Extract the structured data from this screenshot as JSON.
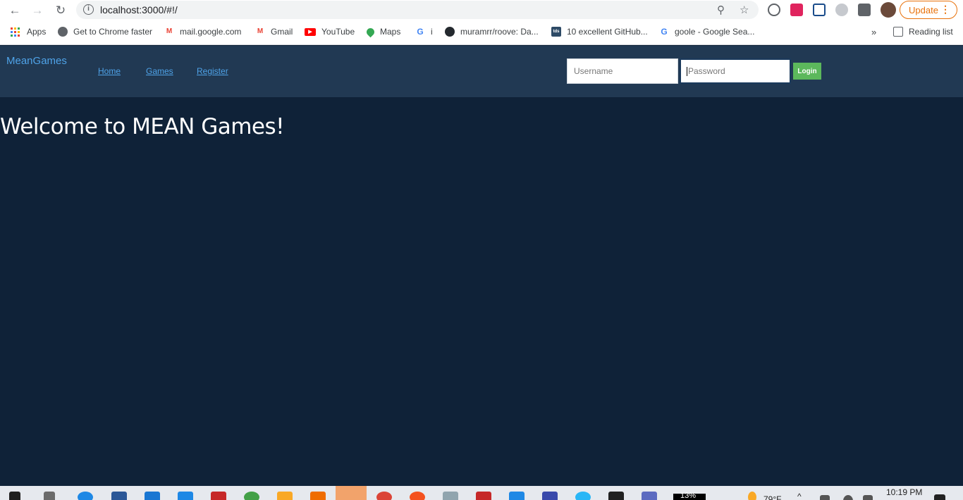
{
  "browser": {
    "url": "localhost:3000/#!/",
    "update_label": "Update",
    "reading_list_label": "Reading list",
    "more_bookmarks": "»"
  },
  "bookmarks": [
    {
      "label": "Apps",
      "icon": "apps-grid-icon"
    },
    {
      "label": "Get to Chrome faster",
      "icon": "chrome-globe-icon"
    },
    {
      "label": "mail.google.com",
      "icon": "gmail-icon"
    },
    {
      "label": "Gmail",
      "icon": "gmail-icon"
    },
    {
      "label": "YouTube",
      "icon": "youtube-icon"
    },
    {
      "label": "Maps",
      "icon": "maps-pin-icon"
    },
    {
      "label": "i",
      "icon": "google-icon"
    },
    {
      "label": "muramrr/roove: Da...",
      "icon": "github-icon"
    },
    {
      "label": "10 excellent GitHub...",
      "icon": "tds-icon"
    },
    {
      "label": "goole - Google Sea...",
      "icon": "google-icon"
    }
  ],
  "app": {
    "brand": "MeanGames",
    "nav": [
      "Home",
      "Games",
      "Register"
    ],
    "username_placeholder": "Username",
    "password_placeholder": "Password",
    "login_label": "Login",
    "welcome": "Welcome to MEAN Games!"
  },
  "taskbar": {
    "time": "10:19 PM",
    "battery": "13%",
    "weather": "79°F"
  },
  "colors": {
    "page_bg": "#0f2238",
    "header_bg": "#213953",
    "link": "#4fa3e8",
    "login_button": "#5cb85c"
  }
}
